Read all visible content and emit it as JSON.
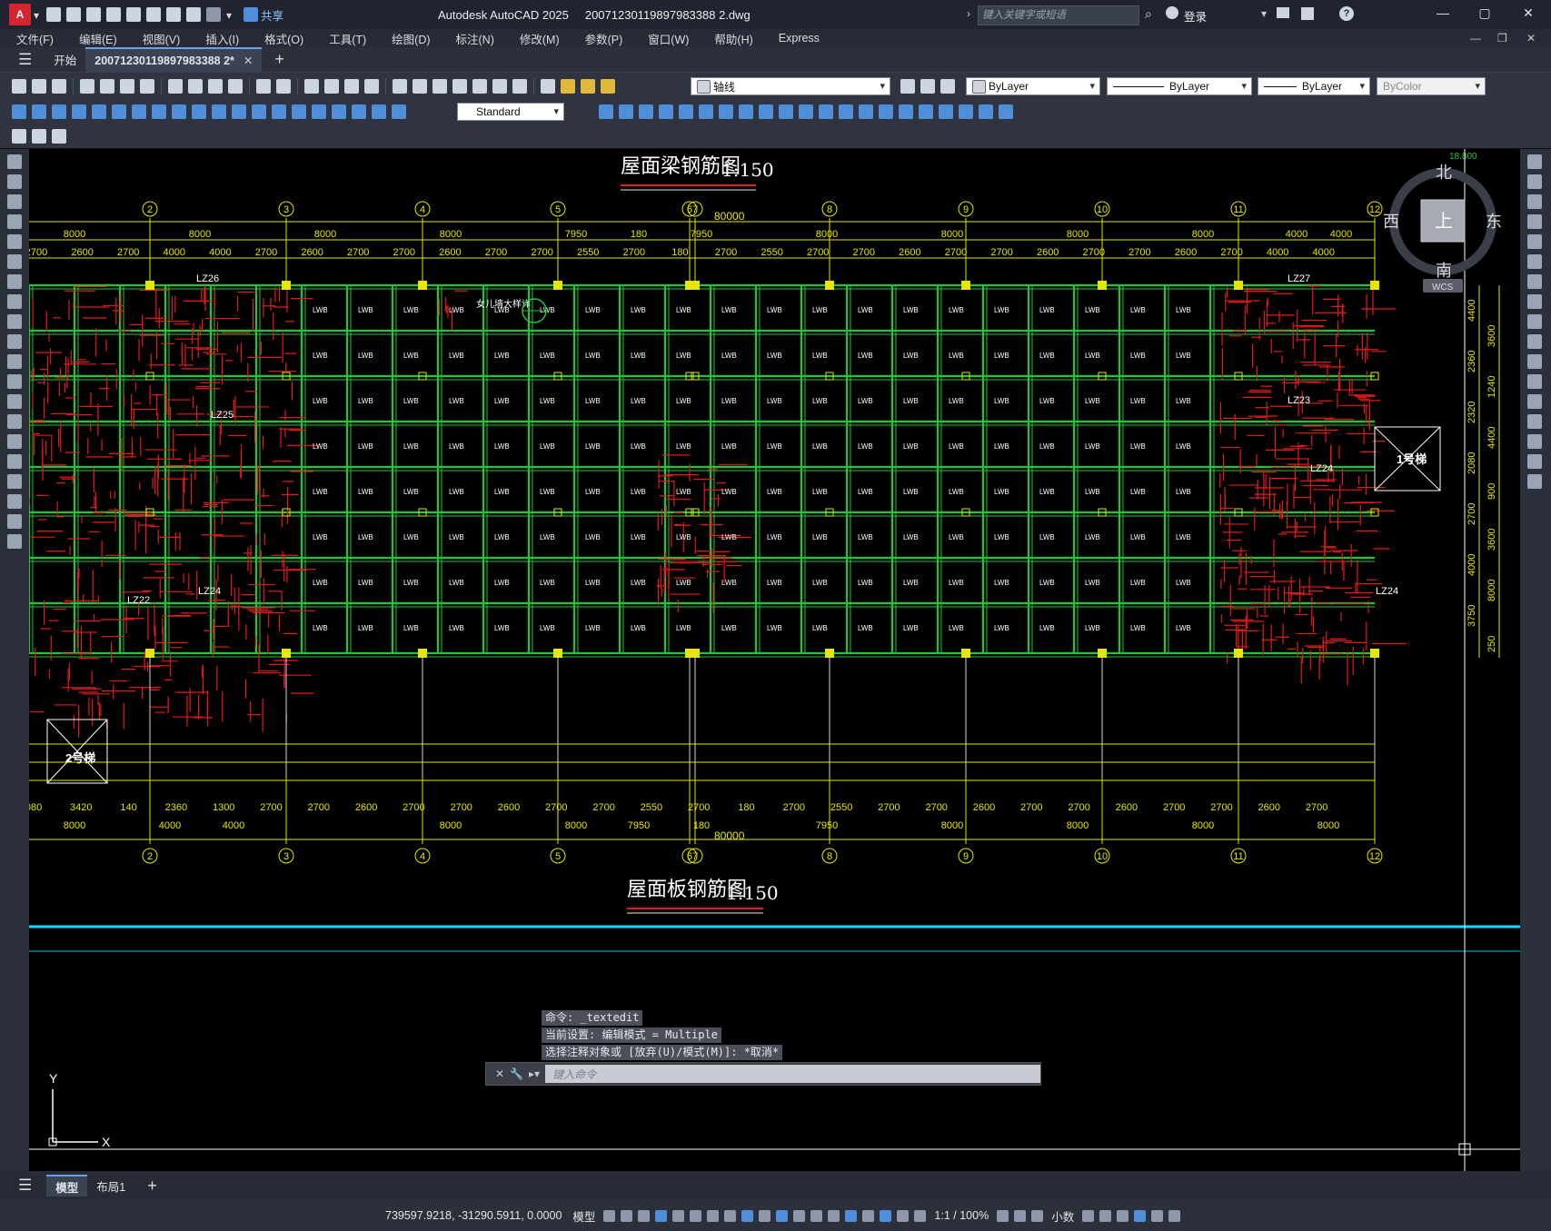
{
  "app": {
    "title": "Autodesk AutoCAD 2025",
    "filename": "20071230119897983388 2.dwg",
    "share_label": "共享",
    "search_placeholder": "键入关键字或短语",
    "login_label": "登录"
  },
  "menus": [
    "文件(F)",
    "编辑(E)",
    "视图(V)",
    "插入(I)",
    "格式(O)",
    "工具(T)",
    "绘图(D)",
    "标注(N)",
    "修改(M)",
    "参数(P)",
    "窗口(W)",
    "帮助(H)",
    "Express"
  ],
  "tabs": {
    "start": "开始",
    "doc": "20071230119897983388 2*"
  },
  "toolbar": {
    "layer": "轴线",
    "color": "ByLayer",
    "linetype": "ByLayer",
    "lineweight": "ByLayer",
    "plotstyle": "ByColor",
    "textstyle": "Standard"
  },
  "drawing": {
    "title_top": "屋面梁钢筋图",
    "title_bottom": "屋面板钢筋图",
    "scale": "1:150",
    "total_dim": "80000",
    "axes": [
      "2",
      "3",
      "4",
      "5",
      "6",
      "7",
      "8",
      "9",
      "10",
      "11",
      "12"
    ],
    "spans_top": [
      "8000",
      "8000",
      "8000",
      "8000",
      "7950",
      "180",
      "7950",
      "8000",
      "8000",
      "8000",
      "8000",
      "4000",
      "4000"
    ],
    "subspans_top": [
      "2700",
      "2600",
      "2700",
      "4000",
      "4000",
      "2700",
      "2600",
      "2700",
      "2700",
      "2600",
      "2700",
      "2700",
      "2550",
      "2700",
      "180",
      "2700",
      "2550",
      "2700",
      "2700",
      "2600",
      "2700",
      "2700",
      "2600",
      "2700",
      "2700",
      "2600",
      "2700",
      "4000",
      "4000"
    ],
    "spans_bottom": [
      "8000",
      "4000",
      "4000",
      "8000",
      "8000",
      "7950",
      "180",
      "7950",
      "8000",
      "8000",
      "8000",
      "8000"
    ],
    "subspans_bottom": [
      "080",
      "3420",
      "140",
      "2360",
      "1300",
      "2700",
      "2700",
      "2600",
      "2700",
      "2700",
      "2600",
      "2700",
      "2700",
      "2550",
      "2700",
      "180",
      "2700",
      "2550",
      "2700",
      "2700",
      "2600",
      "2700",
      "2700",
      "2600",
      "2700",
      "2700",
      "2600",
      "2700"
    ],
    "right_dims": [
      "4400",
      "3600",
      "2360",
      "1240",
      "2320",
      "4400",
      "2080",
      "900",
      "2700",
      "3600",
      "4000",
      "8000",
      "3750",
      "250"
    ],
    "stair1": "1号梯",
    "stair2": "2号梯",
    "beam_labels": [
      "LZ26",
      "LZ27",
      "LZ23",
      "LZ24",
      "LZ25",
      "LZ22",
      "LZ24",
      "LZ24"
    ],
    "cell_label": "LWB",
    "elev": "18.800",
    "note": "女儿墙大样详"
  },
  "viewcube": {
    "north": "北",
    "south": "南",
    "east": "东",
    "west": "西",
    "top": "上",
    "wcs": "WCS"
  },
  "ucs": {
    "x": "X",
    "y": "Y"
  },
  "command": {
    "history": [
      "命令: _textedit",
      "当前设置: 编辑模式 = Multiple",
      "选择注释对象或 [放弃(U)/模式(M)]: *取消*"
    ],
    "placeholder": "键入命令"
  },
  "layout_tabs": [
    "模型",
    "布局1"
  ],
  "status": {
    "coords": "739597.9218, -31290.5911, 0.0000",
    "mode": "模型",
    "scale": "1:1 / 100%",
    "units": "小数"
  },
  "colors": {
    "grid": "#22c53a",
    "axis": "#e6e600",
    "rebar": "#e21b1b",
    "cyan": "#00e0ff",
    "title_red": "#e21b1b"
  }
}
